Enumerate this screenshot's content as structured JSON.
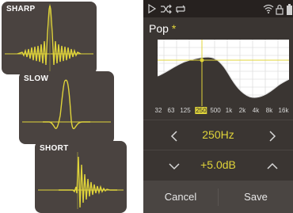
{
  "cards": {
    "sharp": {
      "title": "SHARP"
    },
    "slow": {
      "title": "SLOW"
    },
    "short": {
      "title": "SHORT"
    }
  },
  "colors": {
    "accent": "#e0d43a",
    "card_bg": "#4a4340",
    "phone_bg": "#3a3532",
    "status_bg": "#26211f"
  },
  "status_icons": [
    "play-icon",
    "shuffle-icon",
    "repeat-icon",
    "wifi-icon",
    "lock-icon",
    "battery-icon"
  ],
  "equalizer": {
    "preset_name": "Pop",
    "modified_marker": "*",
    "frequencies": [
      "32",
      "63",
      "125",
      "250",
      "500",
      "1k",
      "2k",
      "4k",
      "8k",
      "16k"
    ],
    "selected_frequency_label": "250",
    "frequency_value": "250Hz",
    "gain_value": "+5.0dB",
    "cancel_label": "Cancel",
    "save_label": "Save"
  }
}
